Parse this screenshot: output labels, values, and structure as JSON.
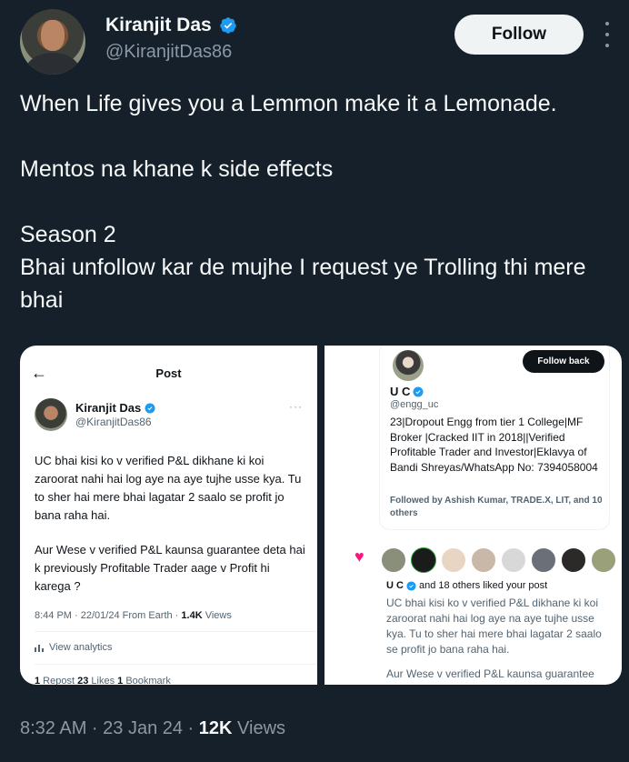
{
  "author": {
    "name": "Kiranjit Das",
    "handle": "@KiranjitDas86",
    "follow_label": "Follow"
  },
  "tweet": {
    "line1": "When Life gives you a Lemmon make it a Lemonade.",
    "line2": "Mentos na khane k side effects",
    "line3": "Season 2",
    "line4": "Bhai unfollow kar de mujhe I request ye Trolling thi mere bhai"
  },
  "left_screenshot": {
    "title": "Post",
    "name": "Kiranjit Das",
    "handle": "@KiranjitDas86",
    "para1": "UC bhai kisi ko v verified P&L dikhane ki koi zaroorat nahi hai log aye na aye tujhe usse kya. Tu to sher hai mere bhai lagatar 2 saalo se profit jo bana raha hai.",
    "para2": "Aur Wese v verified P&L kaunsa guarantee deta hai k previously Profitable Trader aage v Profit hi karega ?",
    "meta_time": "8:44 PM · 22/01/24 From Earth · ",
    "meta_views": "1.4K",
    "meta_views_label": " Views",
    "analytics_label": "View analytics",
    "reposts_count": "1",
    "reposts_label": " Repost  ",
    "likes_count": "23",
    "likes_label": " Likes  ",
    "bookmarks_count": "1",
    "bookmarks_label": " Bookmark"
  },
  "right_screenshot": {
    "follow_back_label": "Follow back",
    "name": "U C",
    "handle": "@engg_uc",
    "bio": "23|Dropout Engg from tier 1 College|MF Broker |Cracked IIT in 2018||Verified Profitable Trader and Investor|Eklavya of Bandi Shreyas/WhatsApp No: 7394058004",
    "followed_by": "Followed by Ashish Kumar, TRADE.X, LIT, and 10 others",
    "liked_name": "U C",
    "liked_text": " and 18 others liked your post",
    "quote_para1": "UC bhai kisi ko v verified P&L dikhane ki koi zaroorat nahi hai log aye na aye tujhe usse kya. Tu to sher hai mere bhai lagatar 2 saalo se profit jo bana raha hai.",
    "quote_para2": "Aur Wese v verified P&L kaunsa guarantee"
  },
  "footer": {
    "time": "8:32 AM · 23 Jan 24 · ",
    "views": "12K",
    "views_label": " Views"
  },
  "colors": {
    "background": "#15202b",
    "verified": "#1d9bf0",
    "heart": "#f91880"
  }
}
